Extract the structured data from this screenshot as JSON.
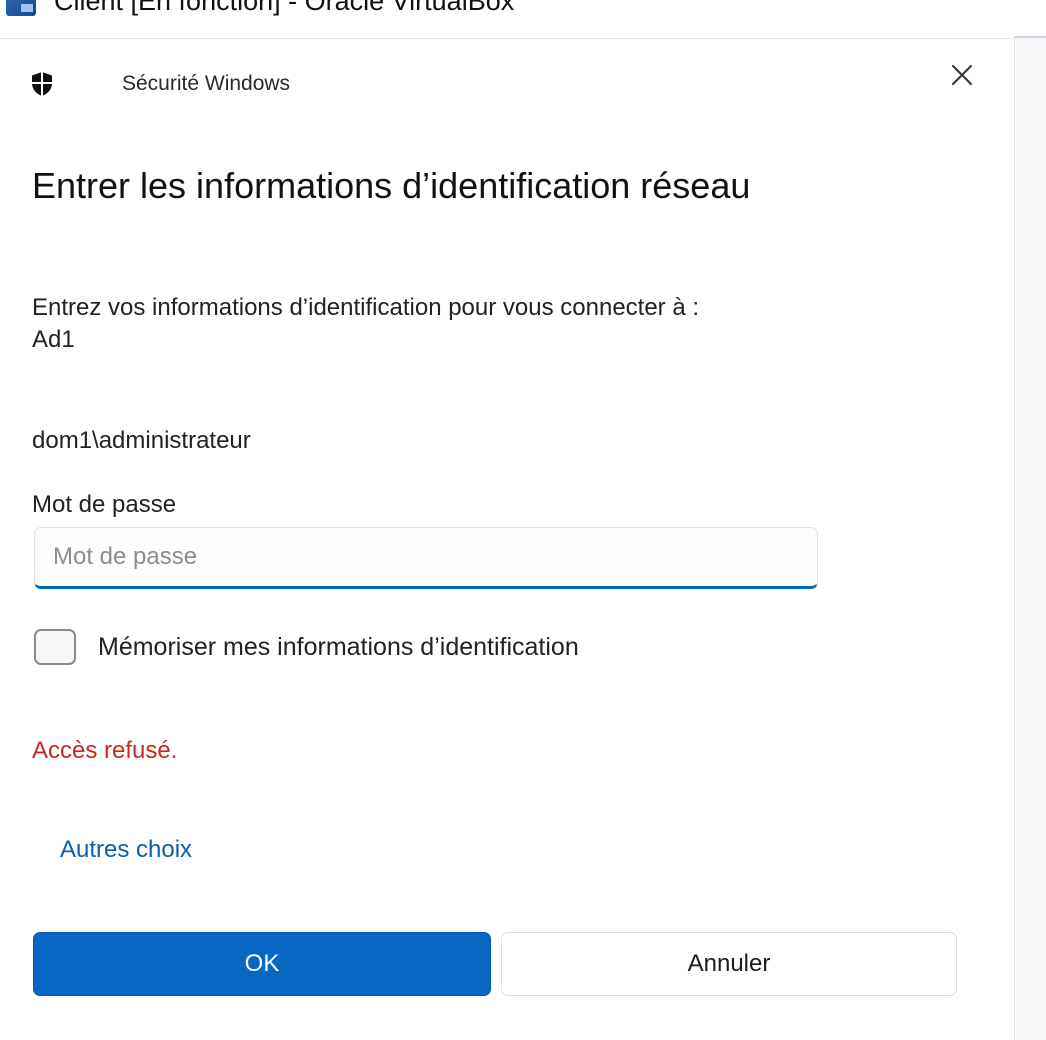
{
  "window": {
    "title": "Client [En fonction] - Oracle VirtualBox"
  },
  "dialog": {
    "app_name": "Sécurité Windows",
    "title": "Entrer les informations d’identification réseau",
    "instructions_line1": "Entrez vos informations d’identification pour vous connecter à :",
    "instructions_line2": "Ad1",
    "username": "dom1\\administrateur",
    "password_label": "Mot de passe",
    "password_placeholder": "Mot de passe",
    "password_value": "",
    "remember_label": "Mémoriser mes informations d’identification",
    "remember_checked": false,
    "error_text": "Accès refusé.",
    "more_choices_label": "Autres choix",
    "ok_label": "OK",
    "cancel_label": "Annuler"
  },
  "icons": {
    "app": "shield-icon",
    "close": "close-icon",
    "window": "virtualbox-icon"
  },
  "colors": {
    "accent": "#0967c4",
    "error": "#c42b1c",
    "link": "#0d5ea8"
  }
}
